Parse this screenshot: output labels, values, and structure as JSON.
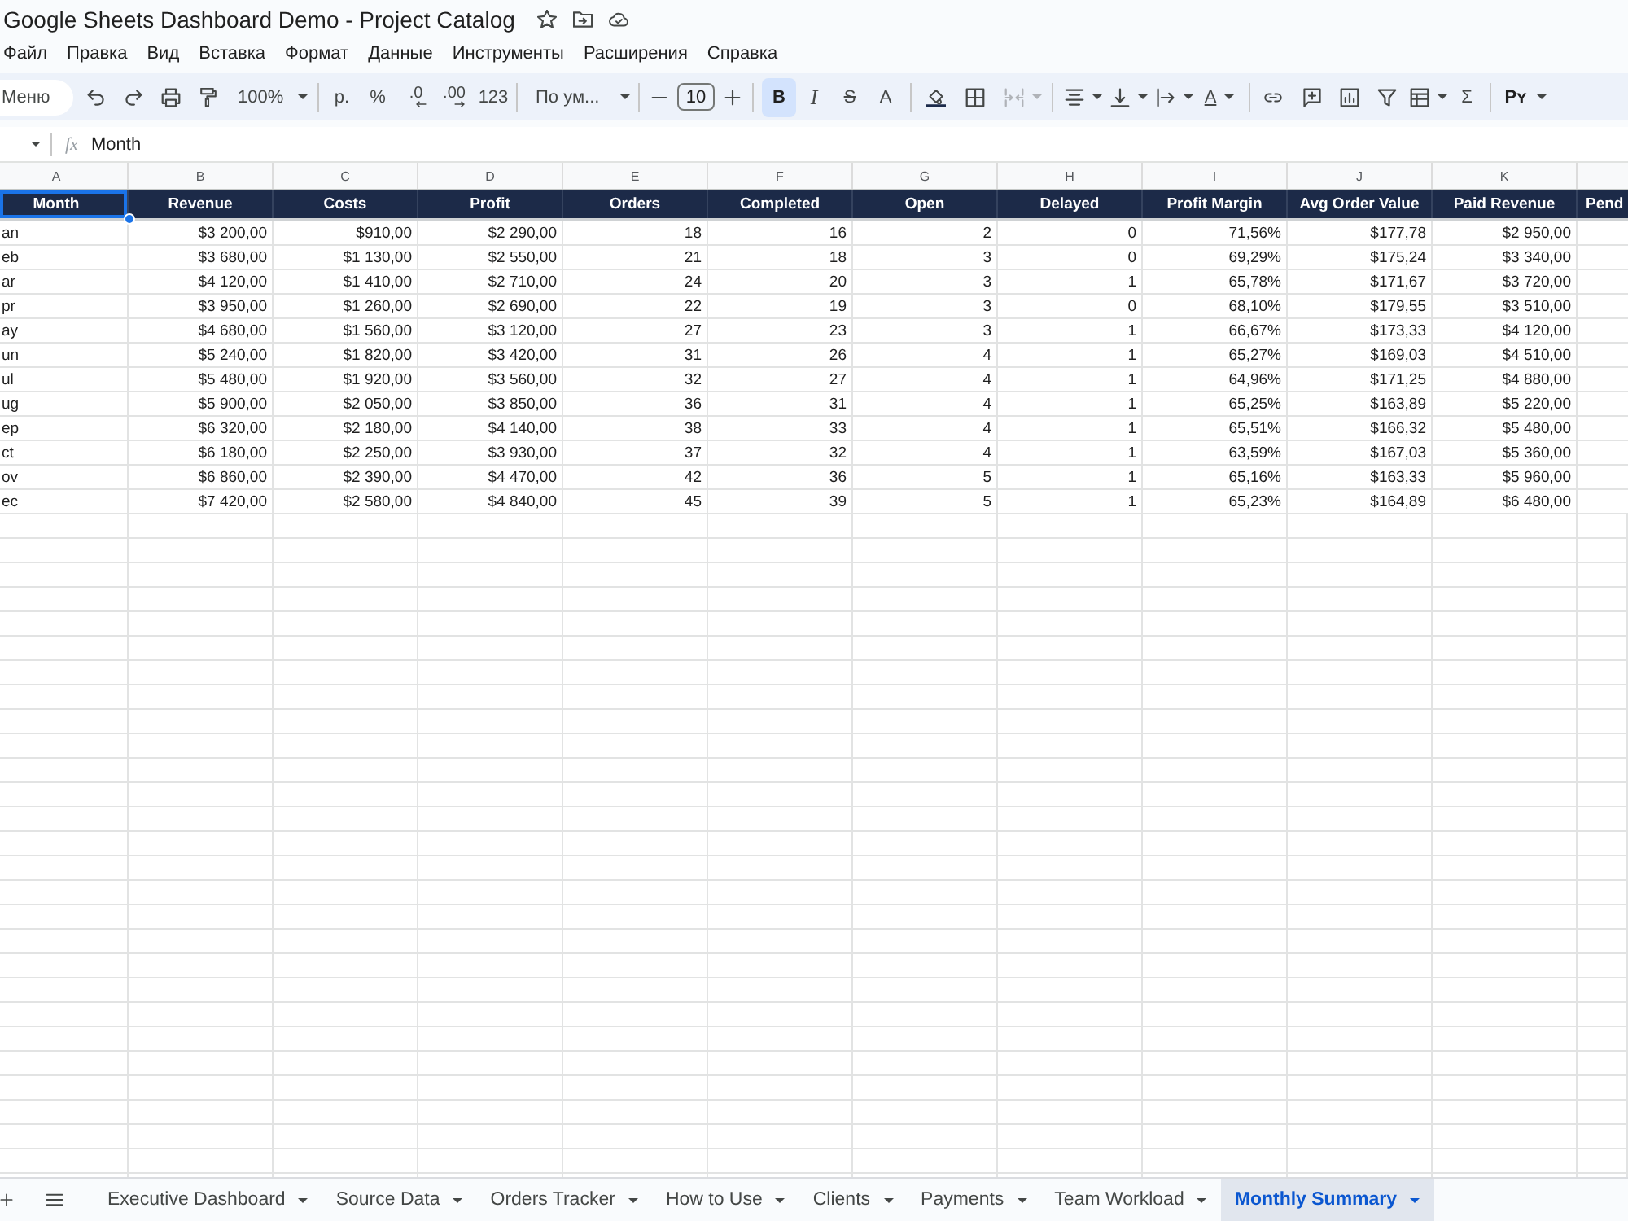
{
  "window": {
    "title": "Google Sheets Dashboard Demo - Project Catalog"
  },
  "menu_bar": [
    "Файл",
    "Правка",
    "Вид",
    "Вставка",
    "Формат",
    "Данные",
    "Инструменты",
    "Расширения",
    "Справка"
  ],
  "toolbar": {
    "search": {
      "placeholder": "Меню"
    },
    "zoom": "100%",
    "currency": "р.",
    "percent": "%",
    "decrease_decimal": ".0",
    "increase_decimal": ".00",
    "more_formats": "123",
    "font": "По ум...",
    "font_size": "10",
    "bold": {
      "label": "B",
      "selected": true
    },
    "italic": "I",
    "strikethrough": "S",
    "text_color": "A",
    "merge_cells": {
      "disabled": true
    },
    "text_rotation": "A",
    "functions": "Σ",
    "input_tools": "Pʏ"
  },
  "formula_bar": {
    "function_label": "fx",
    "value": "Month"
  },
  "grid": {
    "column_letters": [
      "A",
      "B",
      "C",
      "D",
      "E",
      "F",
      "G",
      "H",
      "I",
      "J",
      "K"
    ],
    "header_cells": [
      {
        "text": "Month",
        "selected": true
      },
      {
        "text": "Revenue",
        "selected": false
      },
      {
        "text": "Costs",
        "selected": false
      },
      {
        "text": "Profit",
        "selected": false
      },
      {
        "text": "Orders",
        "selected": false
      },
      {
        "text": "Completed",
        "selected": false
      },
      {
        "text": "Open",
        "selected": false
      },
      {
        "text": "Delayed",
        "selected": false
      },
      {
        "text": "Profit Margin",
        "selected": false
      },
      {
        "text": "Avg Order Value",
        "selected": false
      },
      {
        "text": "Paid Revenue",
        "selected": false
      },
      {
        "text": "Pend",
        "selected": false
      }
    ],
    "rows": [
      [
        "an",
        "$3 200,00",
        "$910,00",
        "$2 290,00",
        "18",
        "16",
        "2",
        "0",
        "71,56%",
        "$177,78",
        "$2 950,00"
      ],
      [
        "eb",
        "$3 680,00",
        "$1 130,00",
        "$2 550,00",
        "21",
        "18",
        "3",
        "0",
        "69,29%",
        "$175,24",
        "$3 340,00"
      ],
      [
        "ar",
        "$4 120,00",
        "$1 410,00",
        "$2 710,00",
        "24",
        "20",
        "3",
        "1",
        "65,78%",
        "$171,67",
        "$3 720,00"
      ],
      [
        "pr",
        "$3 950,00",
        "$1 260,00",
        "$2 690,00",
        "22",
        "19",
        "3",
        "0",
        "68,10%",
        "$179,55",
        "$3 510,00"
      ],
      [
        "ay",
        "$4 680,00",
        "$1 560,00",
        "$3 120,00",
        "27",
        "23",
        "3",
        "1",
        "66,67%",
        "$173,33",
        "$4 120,00"
      ],
      [
        "un",
        "$5 240,00",
        "$1 820,00",
        "$3 420,00",
        "31",
        "26",
        "4",
        "1",
        "65,27%",
        "$169,03",
        "$4 510,00"
      ],
      [
        "ul",
        "$5 480,00",
        "$1 920,00",
        "$3 560,00",
        "32",
        "27",
        "4",
        "1",
        "64,96%",
        "$171,25",
        "$4 880,00"
      ],
      [
        "ug",
        "$5 900,00",
        "$2 050,00",
        "$3 850,00",
        "36",
        "31",
        "4",
        "1",
        "65,25%",
        "$163,89",
        "$5 220,00"
      ],
      [
        "ep",
        "$6 320,00",
        "$2 180,00",
        "$4 140,00",
        "38",
        "33",
        "4",
        "1",
        "65,51%",
        "$166,32",
        "$5 480,00"
      ],
      [
        "ct",
        "$6 180,00",
        "$2 250,00",
        "$3 930,00",
        "37",
        "32",
        "4",
        "1",
        "63,59%",
        "$167,03",
        "$5 360,00"
      ],
      [
        "ov",
        "$6 860,00",
        "$2 390,00",
        "$4 470,00",
        "42",
        "36",
        "5",
        "1",
        "65,16%",
        "$163,33",
        "$5 960,00"
      ],
      [
        "ec",
        "$7 420,00",
        "$2 580,00",
        "$4 840,00",
        "45",
        "39",
        "5",
        "1",
        "65,23%",
        "$164,89",
        "$6 480,00"
      ]
    ]
  },
  "sheet_tabs": [
    {
      "label": "Executive Dashboard",
      "selected": false
    },
    {
      "label": "Source Data",
      "selected": false
    },
    {
      "label": "Orders Tracker",
      "selected": false
    },
    {
      "label": "How to Use",
      "selected": false
    },
    {
      "label": "Clients",
      "selected": false
    },
    {
      "label": "Payments",
      "selected": false
    },
    {
      "label": "Team Workload",
      "selected": false
    },
    {
      "label": "Monthly Summary",
      "selected": true
    }
  ]
}
